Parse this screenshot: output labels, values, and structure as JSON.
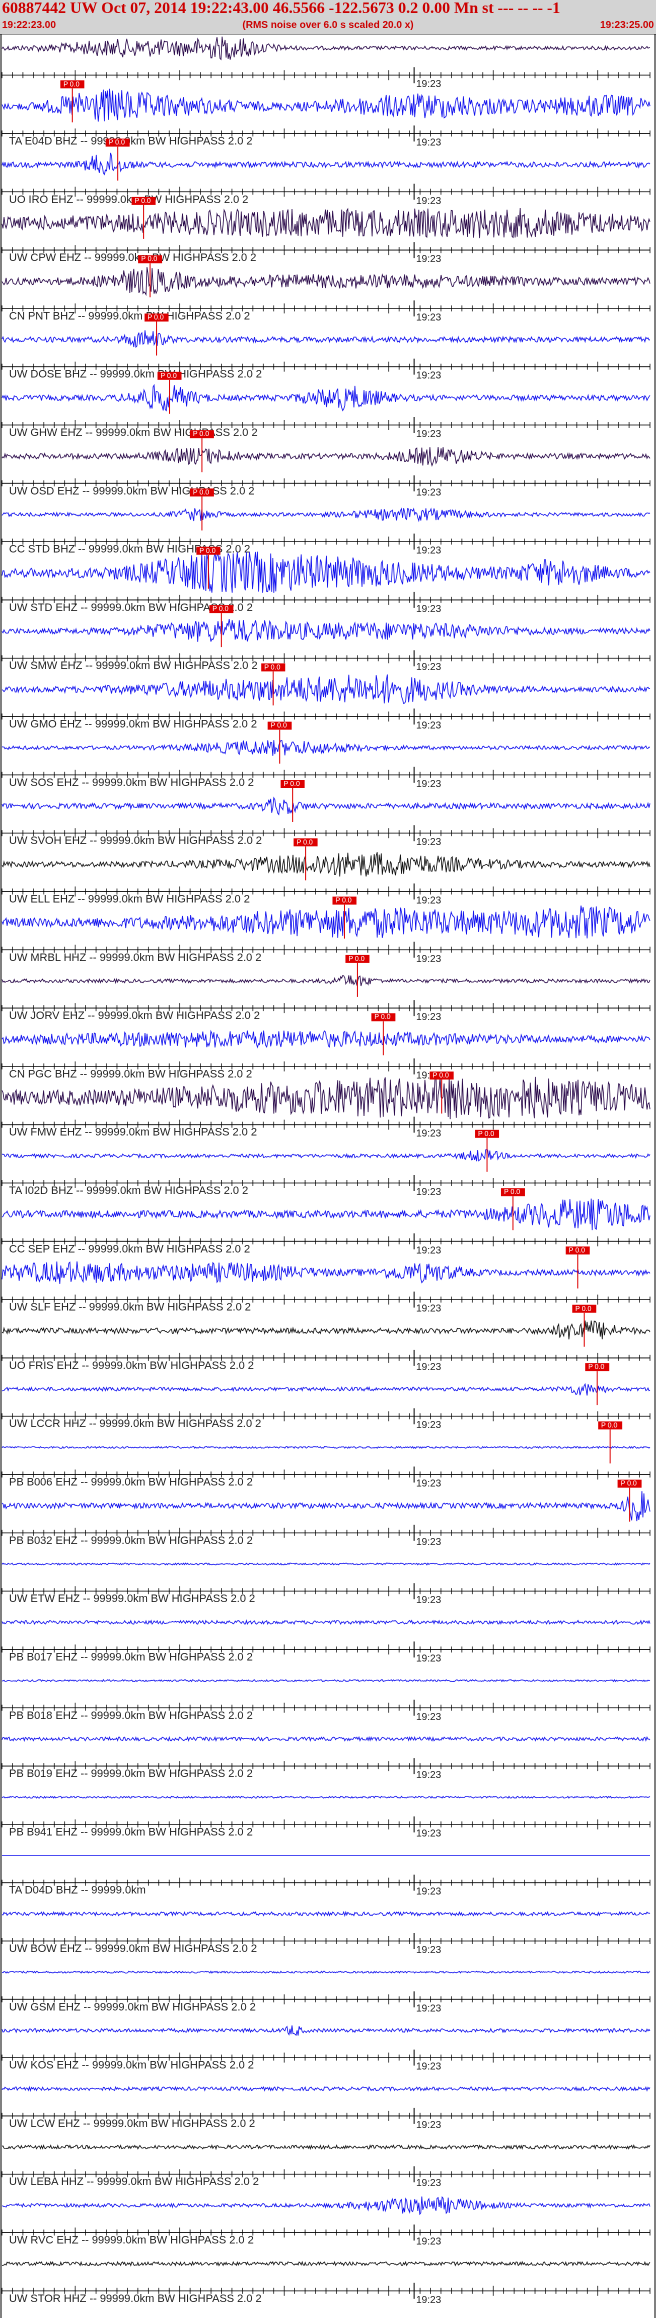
{
  "header": {
    "title": "60887442 UW Oct 07, 2014 19:22:43.00   46.5566 -122.5673  0.2 0.00 Mn st --- -- --  -1",
    "start_time": "19:22:23.00",
    "rms_note": "(RMS noise over 6.0 s scaled 20.0 x)",
    "end_time": "19:23:25.00"
  },
  "minute_label": "19:23",
  "colors": {
    "blue": "#1111ee",
    "dark": "#2a0a4a",
    "black": "#111111",
    "pick": "#dd0000",
    "header_text": "#cc0000"
  },
  "pick_label": "P 0.0",
  "traces": [
    {
      "label": "",
      "color": "dark",
      "pick": null,
      "bursts": [
        [
          0.2,
          0.6,
          0.2
        ],
        [
          0.35,
          0.7,
          0.1
        ]
      ],
      "amp": 2
    },
    {
      "label": "TA E04D BHZ -- 99999.0km BW  HIGHPASS  2.0  2",
      "color": "blue",
      "pick": 0.09,
      "bursts": [
        [
          0.15,
          0.9,
          0.12
        ],
        [
          0.25,
          0.6,
          0.2
        ],
        [
          0.65,
          0.8,
          0.25
        ],
        [
          0.93,
          0.7,
          0.15
        ]
      ],
      "amp": 3
    },
    {
      "label": "UO IRO EHZ -- 99999.0km BW  HIGHPASS  2.0  2",
      "color": "blue",
      "pick": 0.16,
      "bursts": [
        [
          0.16,
          0.8,
          0.05
        ]
      ],
      "amp": 3
    },
    {
      "label": "UW CPW EHZ -- 99999.0km BW  HIGHPASS  2.0  2",
      "color": "dark",
      "pick": 0.2,
      "bursts": [
        [
          0.45,
          0.7,
          0.5
        ],
        [
          0.8,
          0.6,
          0.3
        ]
      ],
      "amp": 6
    },
    {
      "label": "CN PNT BHZ -- 99999.0km BW  HIGHPASS  2.0  2",
      "color": "dark",
      "pick": 0.21,
      "bursts": [
        [
          0.22,
          0.8,
          0.1
        ],
        [
          0.55,
          0.3,
          0.4
        ]
      ],
      "amp": 4
    },
    {
      "label": "UW DOSE BHZ -- 99999.0km BW  HIGHPASS  2.0  2",
      "color": "blue",
      "pick": 0.22,
      "bursts": [
        [
          0.22,
          0.6,
          0.05
        ]
      ],
      "amp": 3
    },
    {
      "label": "UW GHW EHZ -- 99999.0km BW  HIGHPASS  2.0  2",
      "color": "blue",
      "pick": 0.24,
      "bursts": [
        [
          0.25,
          0.9,
          0.08
        ],
        [
          0.53,
          0.8,
          0.1
        ]
      ],
      "amp": 3
    },
    {
      "label": "UW OSD EHZ -- 99999.0km BW  HIGHPASS  2.0  2",
      "color": "dark",
      "pick": 0.29,
      "bursts": [
        [
          0.3,
          0.5,
          0.1
        ],
        [
          0.67,
          0.6,
          0.1
        ]
      ],
      "amp": 3
    },
    {
      "label": "CC STD BHZ -- 99999.0km BW  HIGHPASS  2.0  2",
      "color": "blue",
      "pick": 0.29,
      "bursts": [
        [
          0.3,
          0.4,
          0.05
        ],
        [
          0.63,
          0.4,
          0.15
        ]
      ],
      "amp": 2
    },
    {
      "label": "UW STD EHZ -- 99999.0km BW  HIGHPASS  2.0  2",
      "color": "blue",
      "pick": 0.3,
      "bursts": [
        [
          0.33,
          1.0,
          0.2
        ],
        [
          0.5,
          0.9,
          0.3
        ],
        [
          0.86,
          0.8,
          0.1
        ]
      ],
      "amp": 5
    },
    {
      "label": "UW SMW EHZ -- 99999.0km BW  HIGHPASS  2.0  2",
      "color": "blue",
      "pick": 0.32,
      "bursts": [
        [
          0.34,
          0.7,
          0.2
        ],
        [
          0.6,
          0.5,
          0.3
        ]
      ],
      "amp": 3
    },
    {
      "label": "UW GMO EHZ -- 99999.0km BW  HIGHPASS  2.0  2",
      "color": "blue",
      "pick": 0.4,
      "bursts": [
        [
          0.4,
          0.7,
          0.3
        ],
        [
          0.6,
          0.8,
          0.2
        ]
      ],
      "amp": 3
    },
    {
      "label": "UW SOS EHZ -- 99999.0km BW  HIGHPASS  2.0  2",
      "color": "blue",
      "pick": 0.41,
      "bursts": [
        [
          0.42,
          0.5,
          0.2
        ]
      ],
      "amp": 2
    },
    {
      "label": "UW SVOH EHZ -- 99999.0km BW  HIGHPASS  2.0  2",
      "color": "blue",
      "pick": 0.43,
      "bursts": [
        [
          0.43,
          0.5,
          0.05
        ]
      ],
      "amp": 3
    },
    {
      "label": "UW ELL EHZ -- 99999.0km BW  HIGHPASS  2.0  2",
      "color": "black",
      "pick": 0.45,
      "bursts": [
        [
          0.55,
          0.8,
          0.3
        ]
      ],
      "amp": 3
    },
    {
      "label": "UW MRBL HHZ -- 99999.0km BW  HIGHPASS  2.0  2",
      "color": "blue",
      "pick": 0.51,
      "bursts": [
        [
          0.55,
          0.9,
          0.4
        ],
        [
          0.9,
          0.9,
          0.2
        ]
      ],
      "amp": 5
    },
    {
      "label": "UW JORV EHZ -- 99999.0km BW  HIGHPASS  2.0  2",
      "color": "dark",
      "pick": 0.53,
      "bursts": [
        [
          0.54,
          0.4,
          0.05
        ]
      ],
      "amp": 2
    },
    {
      "label": "CN PGC BHZ -- 99999.0km BW  HIGHPASS  2.0  2",
      "color": "blue",
      "pick": 0.57,
      "bursts": [
        [
          0.4,
          0.5,
          0.6
        ]
      ],
      "amp": 3
    },
    {
      "label": "UW FMW EHZ -- 99999.0km BW  HIGHPASS  2.0  2",
      "color": "dark",
      "pick": 0.66,
      "bursts": [
        [
          0.8,
          1.0,
          0.35
        ],
        [
          0.5,
          0.8,
          0.4
        ]
      ],
      "amp": 8
    },
    {
      "label": "TA I02D BHZ -- 99999.0km BW  HIGHPASS  2.0  2",
      "color": "blue",
      "pick": 0.73,
      "bursts": [
        [
          0.74,
          0.4,
          0.05
        ]
      ],
      "amp": 2
    },
    {
      "label": "CC SEP EHZ -- 99999.0km BW  HIGHPASS  2.0  2",
      "color": "blue",
      "pick": 0.77,
      "bursts": [
        [
          0.9,
          1.0,
          0.2
        ]
      ],
      "amp": 4
    },
    {
      "label": "UW SLF EHZ -- 99999.0km BW  HIGHPASS  2.0  2",
      "color": "blue",
      "pick": 0.87,
      "bursts": [
        [
          0.1,
          0.7,
          0.2
        ],
        [
          0.35,
          0.6,
          0.2
        ],
        [
          0.65,
          0.6,
          0.1
        ]
      ],
      "amp": 3
    },
    {
      "label": "UO FRIS EHZ -- 99999.0km BW  HIGHPASS  2.0  2",
      "color": "black",
      "pick": 0.88,
      "bursts": [
        [
          0.9,
          0.7,
          0.08
        ]
      ],
      "amp": 3
    },
    {
      "label": "UW LCCR HHZ -- 99999.0km BW  HIGHPASS  2.0  2",
      "color": "blue",
      "pick": 0.9,
      "bursts": [
        [
          0.9,
          0.4,
          0.05
        ]
      ],
      "amp": 2
    },
    {
      "label": "PB B006 EHZ -- 99999.0km BW  HIGHPASS  2.0  2",
      "color": "blue",
      "pick": 0.92,
      "bursts": [],
      "amp": 1
    },
    {
      "label": "PB B032 EHZ -- 99999.0km BW  HIGHPASS  2.0  2",
      "color": "blue",
      "pick": 0.95,
      "bursts": [
        [
          0.98,
          1.2,
          0.03
        ]
      ],
      "amp": 3
    },
    {
      "label": "UW ETW EHZ -- 99999.0km BW  HIGHPASS  2.0  2",
      "color": "blue",
      "pick": null,
      "bursts": [],
      "amp": 1
    },
    {
      "label": "PB B017 EHZ -- 99999.0km BW  HIGHPASS  2.0  2",
      "color": "blue",
      "pick": null,
      "bursts": [],
      "amp": 2
    },
    {
      "label": "PB B018 EHZ -- 99999.0km BW  HIGHPASS  2.0  2",
      "color": "blue",
      "pick": null,
      "bursts": [],
      "amp": 1
    },
    {
      "label": "PB B019 EHZ -- 99999.0km BW  HIGHPASS  2.0  2",
      "color": "blue",
      "pick": null,
      "bursts": [],
      "amp": 2
    },
    {
      "label": "PB B941 EHZ -- 99999.0km BW  HIGHPASS  2.0  2",
      "color": "blue",
      "pick": null,
      "bursts": [],
      "amp": 1
    },
    {
      "label": "TA D04D BHZ -- 99999.0km",
      "color": "blue",
      "pick": null,
      "bursts": [],
      "amp": 0
    },
    {
      "label": "UW BOW EHZ -- 99999.0km BW  HIGHPASS  2.0  2",
      "color": "blue",
      "pick": null,
      "bursts": [],
      "amp": 2
    },
    {
      "label": "UW GSM EHZ -- 99999.0km BW  HIGHPASS  2.0  2",
      "color": "blue",
      "pick": null,
      "bursts": [],
      "amp": 1
    },
    {
      "label": "UW KOS EHZ -- 99999.0km BW  HIGHPASS  2.0  2",
      "color": "blue",
      "pick": null,
      "bursts": [
        [
          0.45,
          0.4,
          0.02
        ]
      ],
      "amp": 2
    },
    {
      "label": "UW LCW EHZ -- 99999.0km BW  HIGHPASS  2.0  2",
      "color": "blue",
      "pick": null,
      "bursts": [],
      "amp": 2
    },
    {
      "label": "UW LEBA HHZ -- 99999.0km BW  HIGHPASS  2.0  2",
      "color": "black",
      "pick": null,
      "bursts": [],
      "amp": 2
    },
    {
      "label": "UW RVC EHZ -- 99999.0km BW  HIGHPASS  2.0  2",
      "color": "blue",
      "pick": null,
      "bursts": [
        [
          0.65,
          0.6,
          0.15
        ]
      ],
      "amp": 2
    },
    {
      "label": "UW STOR HHZ -- 99999.0km BW  HIGHPASS  2.0  2",
      "color": "black",
      "pick": null,
      "bursts": [],
      "amp": 2
    }
  ]
}
